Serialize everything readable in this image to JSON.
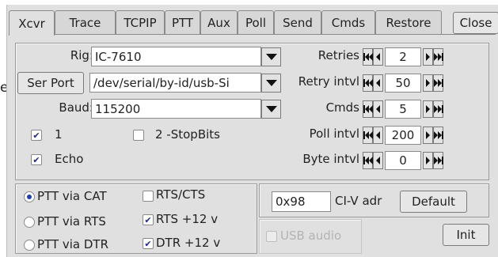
{
  "background_text": "e",
  "tabs": [
    {
      "label": "Xcvr",
      "active": true
    },
    {
      "label": "Trace"
    },
    {
      "label": "TCPIP"
    },
    {
      "label": "PTT"
    },
    {
      "label": "Aux"
    },
    {
      "label": "Poll"
    },
    {
      "label": "Send"
    },
    {
      "label": "Cmds"
    },
    {
      "label": "Restore"
    }
  ],
  "close_label": "Close",
  "rig": {
    "label": "Rig:",
    "value": "IC-7610"
  },
  "serport": {
    "button": "Ser Port",
    "value": "/dev/serial/by-id/usb-Si"
  },
  "baud": {
    "label": "Baud:",
    "value": "115200"
  },
  "stopbits": {
    "one_label": "1",
    "one_checked": true,
    "two_label": "2 -StopBits",
    "two_checked": false
  },
  "echo": {
    "label": "Echo",
    "checked": true
  },
  "spinners": [
    {
      "label": "Retries",
      "value": "2"
    },
    {
      "label": "Retry intvl",
      "value": "50"
    },
    {
      "label": "Cmds",
      "value": "5"
    },
    {
      "label": "Poll intvl",
      "value": "200"
    },
    {
      "label": "Byte intvl",
      "value": "0"
    }
  ],
  "ptt": [
    {
      "label": "PTT via CAT",
      "selected": true
    },
    {
      "label": "PTT via RTS",
      "selected": false
    },
    {
      "label": "PTT via DTR",
      "selected": false
    }
  ],
  "lines": [
    {
      "label": "RTS/CTS",
      "checked": false
    },
    {
      "label": "RTS +12 v",
      "checked": true
    },
    {
      "label": "DTR +12 v",
      "checked": true
    }
  ],
  "civ": {
    "value": "0x98",
    "label": "CI-V adr",
    "default_button": "Default"
  },
  "usb_audio": {
    "label": "USB audio",
    "checked": false,
    "enabled": false
  },
  "init_button": "Init",
  "colors": {
    "dialog_bg": "#e0e0e0",
    "radio_dot": "#1f3fb0",
    "check_mark": "#1a2a8a"
  }
}
